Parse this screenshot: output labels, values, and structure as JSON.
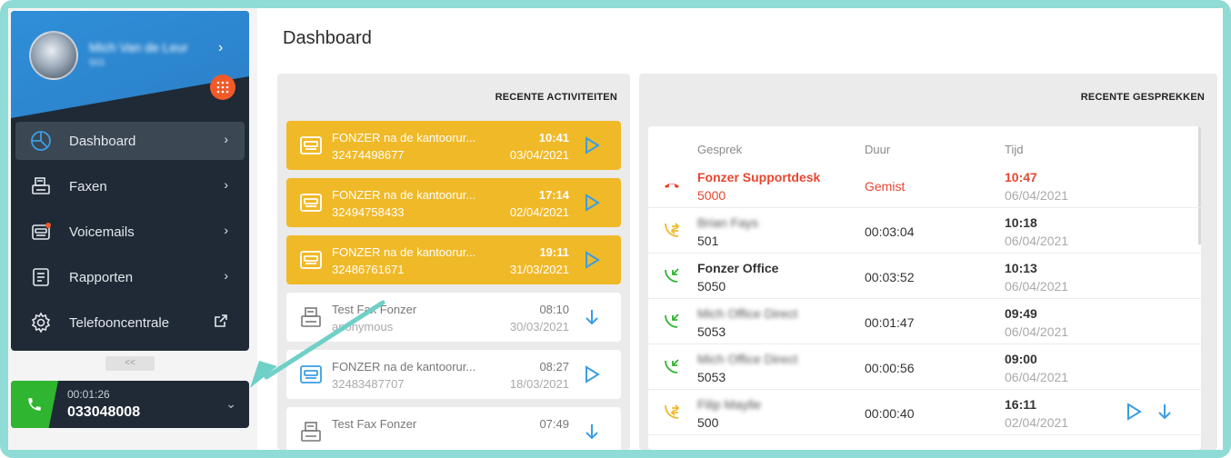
{
  "profile": {
    "name": "Mich Van de Leur",
    "extension": "503"
  },
  "nav": {
    "items": [
      {
        "label": "Dashboard",
        "icon": "dashboard-icon",
        "active": true
      },
      {
        "label": "Faxen",
        "icon": "fax-icon"
      },
      {
        "label": "Voicemails",
        "icon": "voicemail-icon"
      },
      {
        "label": "Rapporten",
        "icon": "reports-icon"
      },
      {
        "label": "Telefooncentrale",
        "icon": "settings-icon"
      }
    ],
    "collapse_label": "<<"
  },
  "active_call": {
    "duration": "00:01:26",
    "number": "033048008"
  },
  "main": {
    "title": "Dashboard"
  },
  "activities": {
    "header": "RECENTE ACTIVITEITEN",
    "items": [
      {
        "type": "voicemail",
        "title": "FONZER na de kantoorur...",
        "number": "32474498677",
        "time": "10:41",
        "date": "03/04/2021",
        "action": "play",
        "highlight": true
      },
      {
        "type": "voicemail",
        "title": "FONZER na de kantoorur...",
        "number": "32494758433",
        "time": "17:14",
        "date": "02/04/2021",
        "action": "play",
        "highlight": true
      },
      {
        "type": "voicemail",
        "title": "FONZER na de kantoorur...",
        "number": "32486761671",
        "time": "19:11",
        "date": "31/03/2021",
        "action": "play",
        "highlight": true
      },
      {
        "type": "fax",
        "title": "Test Fax Fonzer",
        "number": "anonymous",
        "time": "08:10",
        "date": "30/03/2021",
        "action": "download",
        "highlight": false
      },
      {
        "type": "voicemail",
        "title": "FONZER na de kantoorur...",
        "number": "32483487707",
        "time": "08:27",
        "date": "18/03/2021",
        "action": "play",
        "highlight": false
      },
      {
        "type": "fax",
        "title": "Test Fax Fonzer",
        "number": "",
        "time": "07:49",
        "date": "",
        "action": "download",
        "highlight": false
      }
    ]
  },
  "calls": {
    "header": "RECENTE GESPREKKEN",
    "columns": {
      "call": "Gesprek",
      "duration": "Duur",
      "time": "Tijd"
    },
    "rows": [
      {
        "kind": "missed",
        "name": "Fonzer Supportdesk",
        "ext": "5000",
        "duration": "Gemist",
        "time": "10:47",
        "date": "06/04/2021"
      },
      {
        "kind": "transfer",
        "name": "Brian Fays",
        "ext": "501",
        "duration": "00:03:04",
        "time": "10:18",
        "date": "06/04/2021",
        "blur": true
      },
      {
        "kind": "incoming",
        "name": "Fonzer Office",
        "ext": "5050",
        "duration": "00:03:52",
        "time": "10:13",
        "date": "06/04/2021"
      },
      {
        "kind": "incoming",
        "name": "Mich Office Direct",
        "ext": "5053",
        "duration": "00:01:47",
        "time": "09:49",
        "date": "06/04/2021",
        "blur": true
      },
      {
        "kind": "incoming",
        "name": "Mich Office Direct",
        "ext": "5053",
        "duration": "00:00:56",
        "time": "09:00",
        "date": "06/04/2021",
        "blur": true
      },
      {
        "kind": "transfer",
        "name": "Filip Maylle",
        "ext": "500",
        "duration": "00:00:40",
        "time": "16:11",
        "date": "02/04/2021",
        "blur": true,
        "recording": true
      }
    ]
  },
  "colors": {
    "accent": "#f0b928",
    "sidebar": "#1f2a36",
    "missed": "#e8462f",
    "incoming": "#2fb52f",
    "transfer": "#f0b928",
    "play": "#3a9ee4",
    "frame": "#8fdcd6"
  }
}
